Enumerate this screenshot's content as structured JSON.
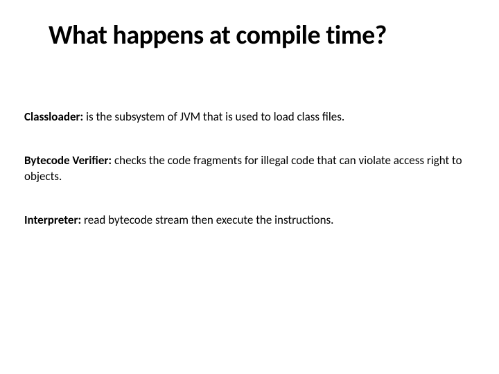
{
  "title": "What happens at compile time?",
  "items": [
    {
      "term": "Classloader:",
      "desc": " is the subsystem of JVM that is used to load class files."
    },
    {
      "term": "Bytecode Verifier:",
      "desc": " checks the code fragments for illegal code that can violate access right to objects."
    },
    {
      "term": "Interpreter:",
      "desc": " read bytecode stream then execute the instructions."
    }
  ]
}
